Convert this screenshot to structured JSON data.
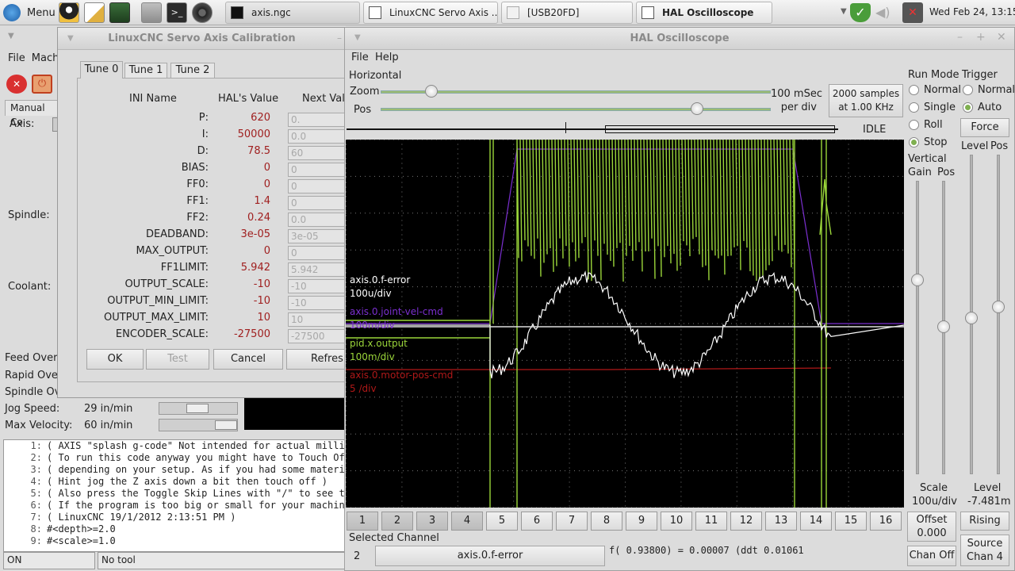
{
  "taskbar": {
    "menu_label": "Menu",
    "tasks": [
      "axis.ngc",
      "LinuxCNC Servo Axis ...",
      "[USB20FD]",
      "HAL Oscilloscope"
    ],
    "clock": "Wed Feb 24, 13:15"
  },
  "axis_window": {
    "menu": [
      "File",
      "Mach"
    ],
    "manual_tab": "Manual Co",
    "axis_label": "Axis:",
    "spindle_label": "Spindle:",
    "coolant_label": "Coolant:",
    "overrides": [
      "Feed Overr",
      "Rapid Over",
      "Spindle Ov"
    ],
    "jog_speed_label": "Jog Speed:",
    "jog_speed_value": "29 in/min",
    "max_velocity_label": "Max Velocity:",
    "max_velocity_value": "60 in/min",
    "code_lines": [
      {
        "num": "1:",
        "text": "( AXIS \"splash g-code\" Not intended for actual millin"
      },
      {
        "num": "2:",
        "text": "( To run this code anyway you might have to Touch Off"
      },
      {
        "num": "3:",
        "text": "( depending on your setup. As if you had some materia"
      },
      {
        "num": "4:",
        "text": "( Hint jog the Z axis down a bit then touch off )"
      },
      {
        "num": "5:",
        "text": "( Also press the Toggle Skip Lines with \"/\" to see th"
      },
      {
        "num": "6:",
        "text": "( If the program is too big or small for your machine"
      },
      {
        "num": "7:",
        "text": "( LinuxCNC 19/1/2012 2:13:51 PM )"
      },
      {
        "num": "8:",
        "text": "#<depth>=2.0"
      },
      {
        "num": "9:",
        "text": "#<scale>=1.0"
      }
    ],
    "status_state": "ON",
    "status_tool": "No tool"
  },
  "calibration": {
    "title": "LinuxCNC Servo Axis Calibration",
    "tabs": [
      "Tune 0",
      "Tune 1",
      "Tune 2"
    ],
    "headers": {
      "ini": "INI Name",
      "hal": "HAL's Value",
      "next": "Next Valu"
    },
    "rows": [
      {
        "name": "P:",
        "hal": "620",
        "next": "0."
      },
      {
        "name": "I:",
        "hal": "50000",
        "next": "0.0"
      },
      {
        "name": "D:",
        "hal": "78.5",
        "next": "60"
      },
      {
        "name": "BIAS:",
        "hal": "0",
        "next": "0"
      },
      {
        "name": "FF0:",
        "hal": "0",
        "next": "0"
      },
      {
        "name": "FF1:",
        "hal": "1.4",
        "next": "0"
      },
      {
        "name": "FF2:",
        "hal": "0.24",
        "next": "0.0"
      },
      {
        "name": "DEADBAND:",
        "hal": "3e-05",
        "next": "3e-05"
      },
      {
        "name": "MAX_OUTPUT:",
        "hal": "0",
        "next": "0"
      },
      {
        "name": "FF1LIMIT:",
        "hal": "5.942",
        "next": "5.942"
      },
      {
        "name": "OUTPUT_SCALE:",
        "hal": "-10",
        "next": "-10"
      },
      {
        "name": "OUTPUT_MIN_LIMIT:",
        "hal": "-10",
        "next": "-10"
      },
      {
        "name": "OUTPUT_MAX_LIMIT:",
        "hal": "10",
        "next": "10"
      },
      {
        "name": "ENCODER_SCALE:",
        "hal": "-27500",
        "next": "-27500"
      }
    ],
    "buttons": {
      "ok": "OK",
      "test": "Test",
      "cancel": "Cancel",
      "refresh": "Refresh"
    }
  },
  "scope": {
    "title": "HAL Oscilloscope",
    "menu": [
      "File",
      "Help"
    ],
    "horizontal_label": "Horizontal",
    "zoom_label": "Zoom",
    "pos_label": "Pos",
    "zoom_fraction": 0.13,
    "pos_fraction": 0.81,
    "timebase_line1": "100 mSec",
    "timebase_line2": "per div",
    "samples_line1": "2000 samples",
    "samples_line2": "at 1.00 KHz",
    "state": "IDLE",
    "run_mode": {
      "label": "Run Mode",
      "options": [
        "Normal",
        "Single",
        "Roll",
        "Stop"
      ],
      "selected": "Stop"
    },
    "trigger": {
      "label": "Trigger",
      "options": [
        "Normal",
        "Auto"
      ],
      "selected": "Auto",
      "force": "Force",
      "level_label": "Level",
      "pos_label": "Pos"
    },
    "vertical": {
      "label": "Vertical",
      "gain_label": "Gain",
      "pos_label": "Pos"
    },
    "traces": [
      {
        "name": "axis.0.f-error",
        "scale": "100u/div",
        "color": "#ffffff"
      },
      {
        "name": "axis.0.joint-vel-cmd",
        "scale": "100m/div",
        "color": "#7b2fd0"
      },
      {
        "name": "pid.x.output",
        "scale": "100m/div",
        "color": "#9bd63a"
      },
      {
        "name": "axis.0.motor-pos-cmd",
        "scale": "5 /div",
        "color": "#b01818"
      }
    ],
    "channels": [
      "1",
      "2",
      "3",
      "4",
      "5",
      "6",
      "7",
      "8",
      "9",
      "10",
      "11",
      "12",
      "13",
      "14",
      "15",
      "16"
    ],
    "active_channels": [
      1,
      2,
      3,
      4
    ],
    "selected_channel_label": "Selected Channel",
    "selected_channel_num": "2",
    "selected_channel_name": "axis.0.f-error",
    "readout": "f( 0.93800) =  0.00007 (ddt  0.01061",
    "scale_label": "Scale",
    "scale_value": "100u/div",
    "offset_label": "Offset",
    "offset_value": "0.000",
    "chan_off": "Chan Off",
    "level_label": "Level",
    "level_value": "-7.481m",
    "rising": "Rising",
    "source_line1": "Source",
    "source_line2": "Chan 4"
  }
}
